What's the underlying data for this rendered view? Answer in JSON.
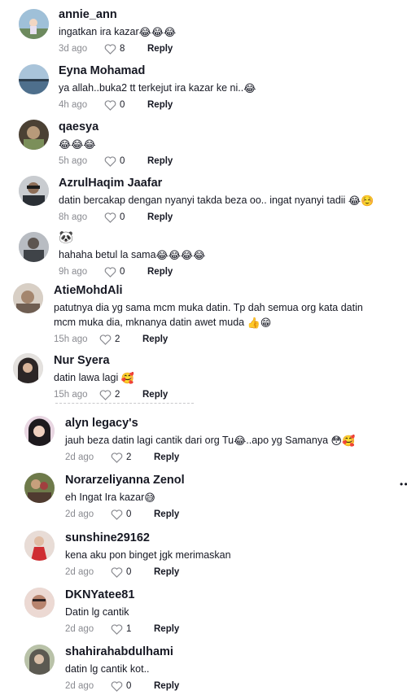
{
  "comments": [
    {
      "username": "annie_ann",
      "text": "ingatkan ira kazar",
      "emojis": "😂😂😂",
      "time": "3d ago",
      "likes": "8",
      "reply": "Reply",
      "avatar_color": "#7fa7c9"
    },
    {
      "username": "Eyna Mohamad",
      "text": "ya allah..buka2 tt terkejut ira kazar ke ni..",
      "emojis": "😂",
      "time": "4h ago",
      "likes": "0",
      "reply": "Reply",
      "avatar_color": "#5b7f9e"
    },
    {
      "username": "qaesya",
      "text": "",
      "emojis": "😂😂😂",
      "time": "5h ago",
      "likes": "0",
      "reply": "Reply",
      "avatar_color": "#6d5f4a"
    },
    {
      "username": "AzrulHaqim Jaafar",
      "text": "datin bercakap dengan nyanyi takda beza oo.. ingat nyanyi tadii",
      "emojis": "😂☺️",
      "time": "8h ago",
      "likes": "0",
      "reply": "Reply",
      "avatar_color": "#3a3f44"
    },
    {
      "username": "🐼",
      "text": "hahaha betul la sama",
      "emojis": "😂😂😂😂",
      "time": "9h ago",
      "likes": "0",
      "reply": "Reply",
      "avatar_color": "#8a8f96"
    },
    {
      "username": "AtieMohdAli",
      "text": "patutnya dia yg sama mcm muka datin. Tp dah semua org kata datin mcm muka dia, mknanya datin awet muda",
      "emojis": "👍😁",
      "time": "15h ago",
      "likes": "2",
      "reply": "Reply",
      "avatar_color": "#9c8a78"
    },
    {
      "username": "Nur Syera",
      "text": "datin lawa lagi",
      "emojis": "🥰",
      "time": "15h ago",
      "likes": "2",
      "reply": "Reply",
      "avatar_color": "#4a3a3a"
    },
    {
      "username": "alyn legacy's",
      "text": "jauh beza datin lagi cantik dari org Tu",
      "emojis_mid": "😂",
      "text2": "..apo yg Samanya",
      "emojis": "😳🥰",
      "time": "2d ago",
      "likes": "2",
      "reply": "Reply",
      "avatar_color": "#b77fa0"
    },
    {
      "username": "Norarzeliyanna Zenol",
      "text": "eh Ingat Ira kazar",
      "emojis": "😅",
      "time": "2d ago",
      "likes": "0",
      "reply": "Reply",
      "avatar_color": "#7a5a48"
    },
    {
      "username": "sunshine29162",
      "text": "kena aku pon binget jgk merimaskan",
      "emojis": "",
      "time": "2d ago",
      "likes": "0",
      "reply": "Reply",
      "avatar_color": "#c44040"
    },
    {
      "username": "DKNYatee81",
      "text": "Datin lg cantik",
      "emojis": "",
      "time": "2d ago",
      "likes": "1",
      "reply": "Reply",
      "avatar_color": "#a8857c"
    },
    {
      "username": "shahirahabdulhami",
      "text": "datin lg cantik kot..",
      "emojis": "",
      "time": "2d ago",
      "likes": "0",
      "reply": "Reply",
      "avatar_color": "#8e9a7c"
    }
  ],
  "more_dots": "• •",
  "colors": {
    "text": "#161823",
    "meta": "#8a8b91"
  },
  "icons": {
    "like": "heart-outline-icon"
  }
}
